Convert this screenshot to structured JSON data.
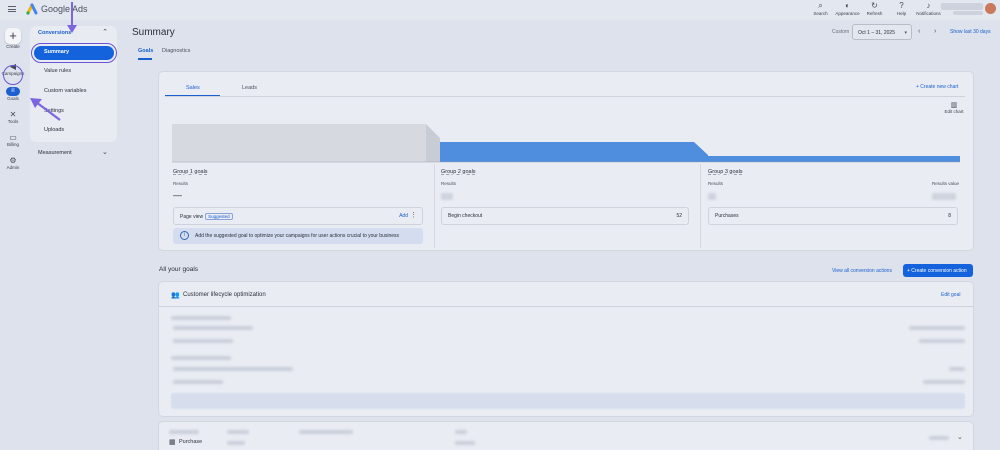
{
  "header": {
    "brand": "Google Ads",
    "tools": [
      {
        "icon": "search-icon",
        "glyph": "⌕",
        "label": "Search"
      },
      {
        "icon": "appearance-icon",
        "glyph": "◐",
        "label": "Appearance"
      },
      {
        "icon": "refresh-icon",
        "glyph": "↻",
        "label": "Refresh"
      },
      {
        "icon": "help-icon",
        "glyph": "?",
        "label": "Help"
      },
      {
        "icon": "bell-icon",
        "glyph": "♪",
        "label": "Notifications"
      }
    ]
  },
  "rail": {
    "create": "Create",
    "campaigns": "Campaigns",
    "goals": "Goals",
    "tools": "Tools",
    "billing": "Billing",
    "admin": "Admin"
  },
  "nav": {
    "section": "Conversions",
    "items": [
      "Summary",
      "Value rules",
      "Custom variables",
      "Settings",
      "Uploads"
    ],
    "measurement": "Measurement"
  },
  "page": {
    "title": "Summary",
    "custom_label": "Custom",
    "date_value": "Oct 1 – 31, 2025",
    "show_range": "Show last 30 days",
    "tabs": [
      "Goals",
      "Diagnostics"
    ]
  },
  "summary_card": {
    "tabs": [
      "Sales",
      "Leads"
    ],
    "create_chart": "+ Create new chart",
    "edit_chart": "Edit chart",
    "groups": [
      {
        "title": "Group 1 goals",
        "results_label": "Results",
        "results_value": "—",
        "row_label": "Page view",
        "chip": "Suggested",
        "row_action": "Add"
      },
      {
        "title": "Group 2 goals",
        "results_label": "Results",
        "row_label": "Begin checkout",
        "row_value": "52"
      },
      {
        "title": "Group 3 goals",
        "results_label": "Results",
        "value_label": "Results value",
        "row_label": "Purchases",
        "row_value": "8"
      }
    ],
    "info": "Add the suggested goal to optimize your campaigns for user actions crucial to your business"
  },
  "all_goals": {
    "title": "All your goals",
    "view_all": "View all conversion actions",
    "create_button": "+ Create conversion action",
    "card_title": "Customer lifecycle optimization",
    "edit_goal": "Edit goal",
    "bottom_row": "Purchase"
  },
  "colors": {
    "accent": "#1463dc",
    "highlight": "#6a55d6"
  }
}
